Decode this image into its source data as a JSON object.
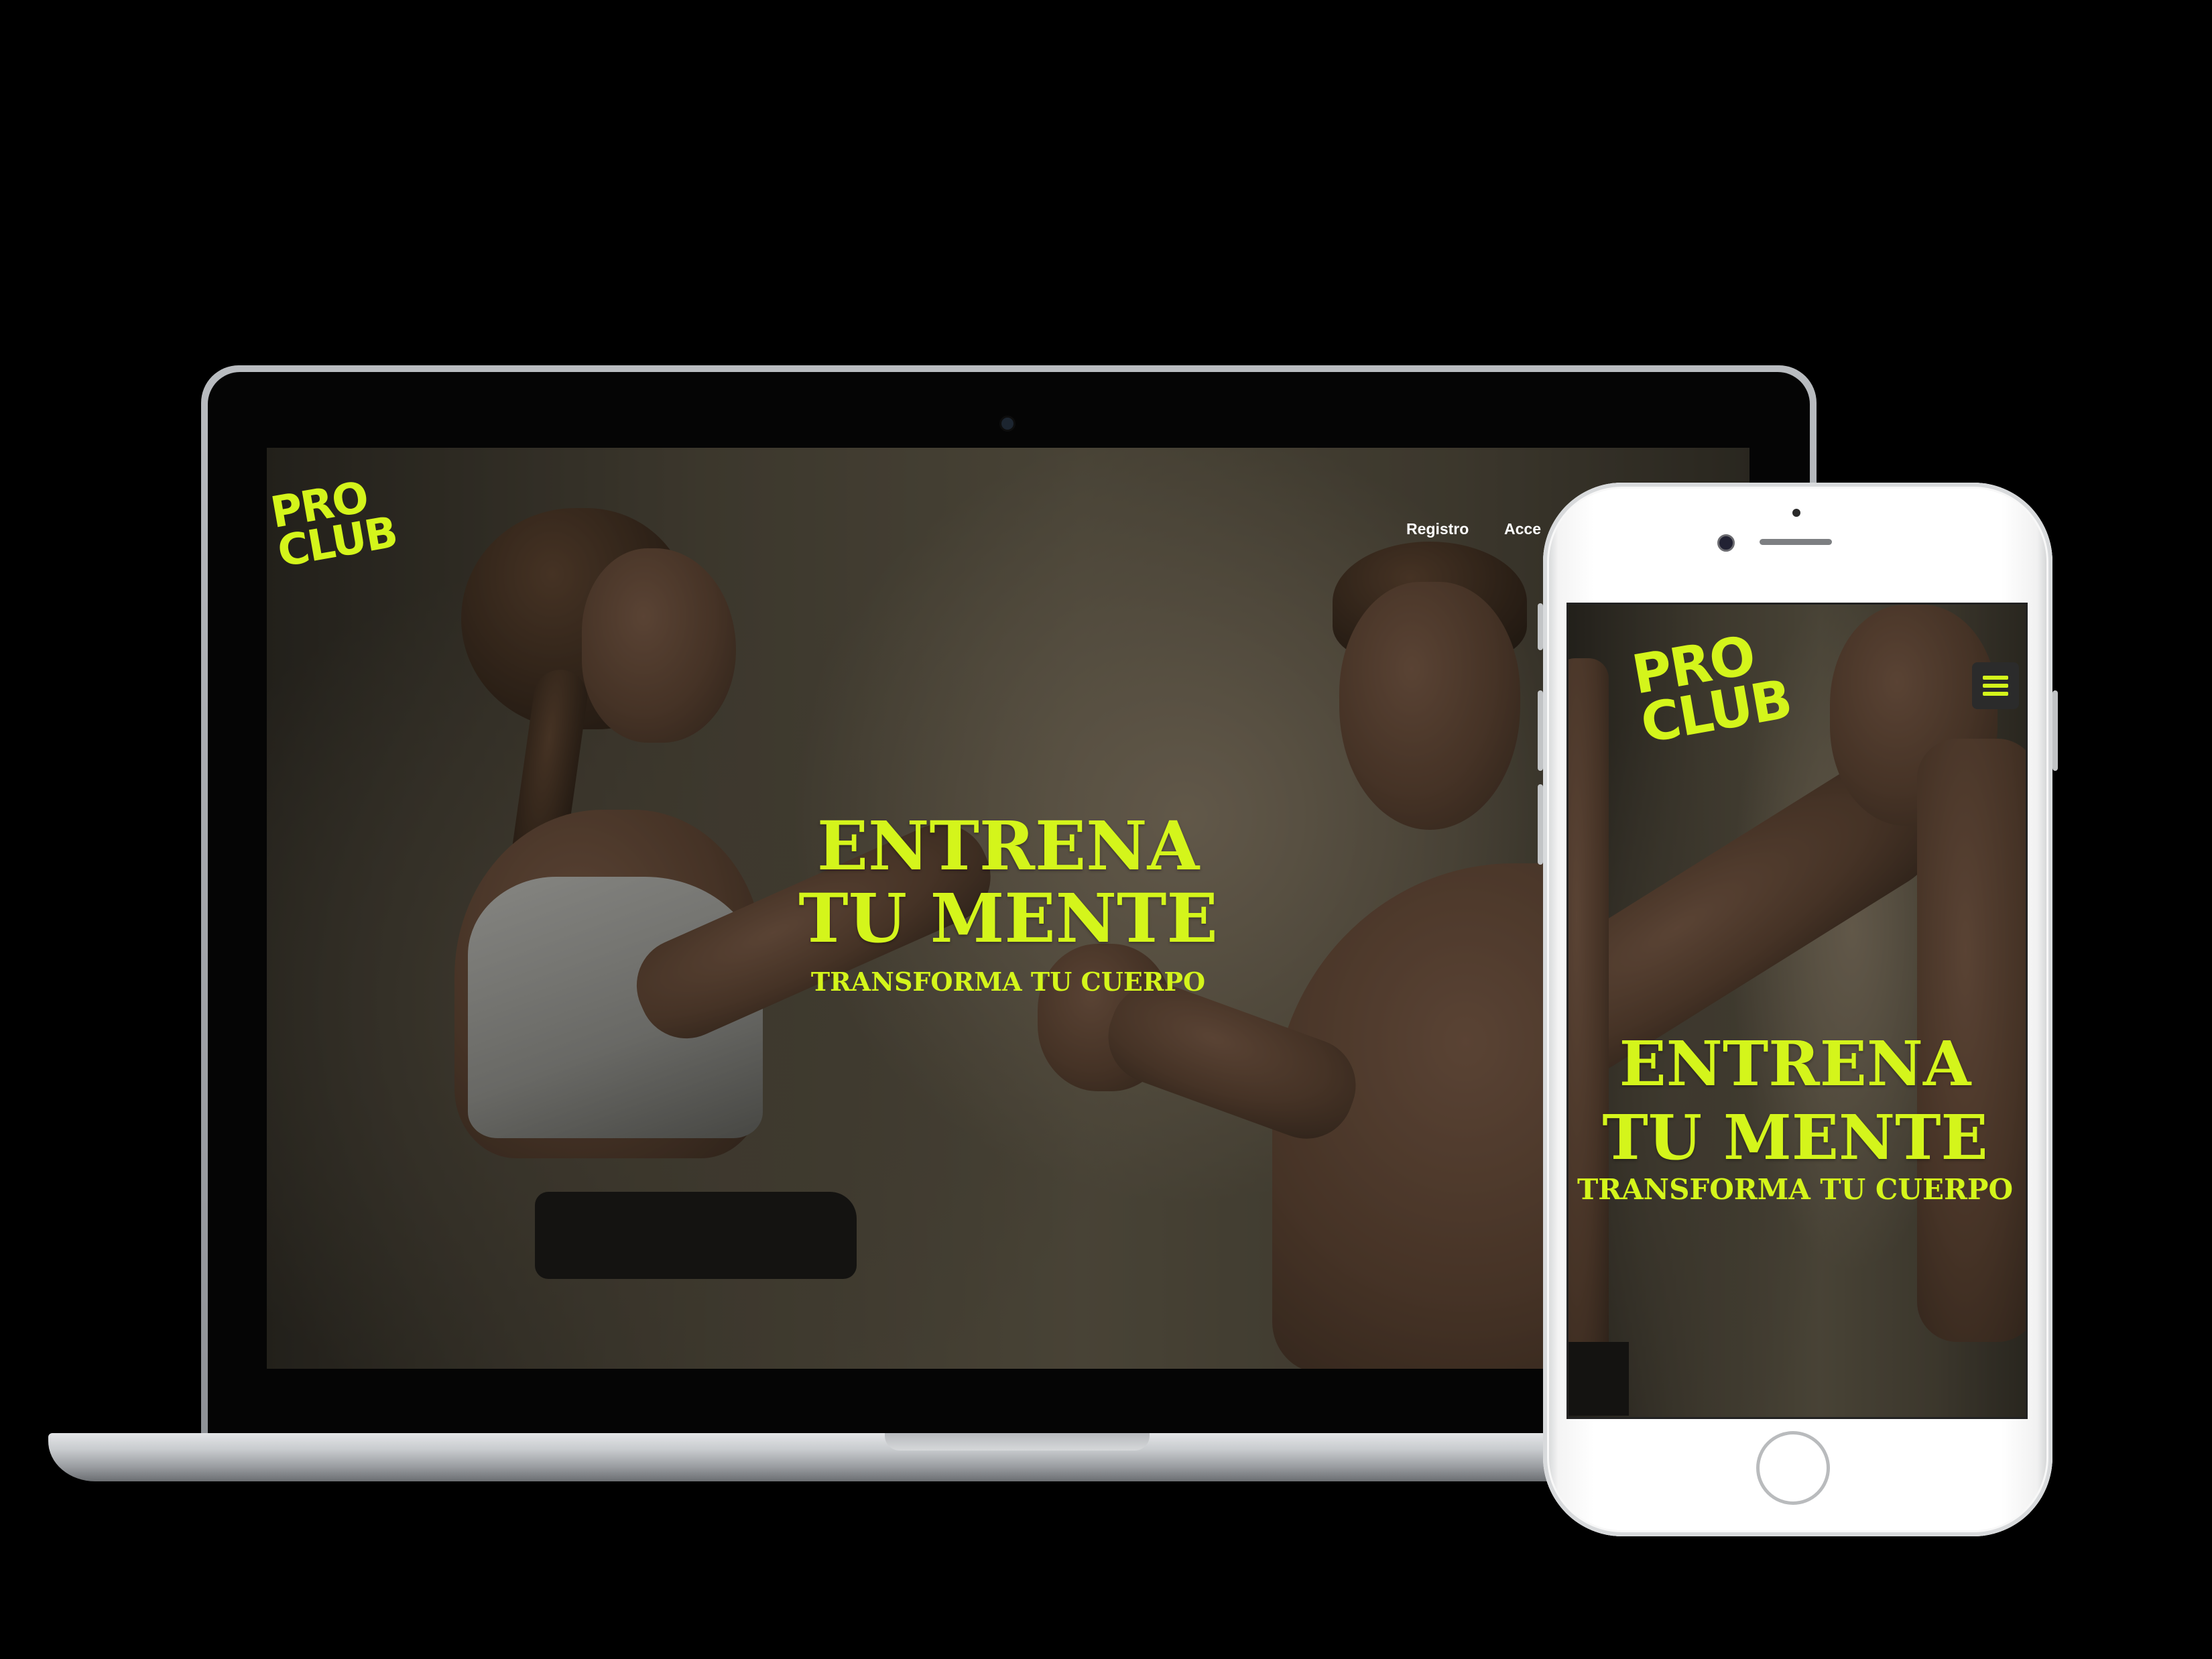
{
  "brand": {
    "line1": "PRO",
    "line2": "CLUB",
    "accent_color": "#d4f51b"
  },
  "desktop": {
    "nav": {
      "items": [
        {
          "label": "Registro"
        },
        {
          "label": "Acce"
        }
      ]
    },
    "hero": {
      "headline_line1": "ENTRENA",
      "headline_line2": "TU MENTE",
      "subheadline": "TRANSFORMA TU CUERPO"
    }
  },
  "mobile": {
    "menu_icon": "hamburger-menu-icon",
    "hero": {
      "headline_line1": "ENTRENA",
      "headline_line2": "TU MENTE",
      "subheadline": "TRANSFORMA TU CUERPO"
    }
  }
}
